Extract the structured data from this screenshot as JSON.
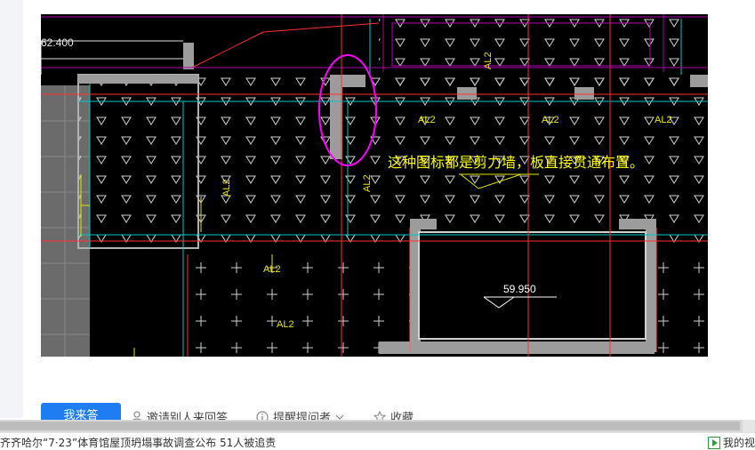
{
  "cad": {
    "elevation_top_left": "62.400",
    "label_al2": "AL2",
    "elevation_center": "59.950",
    "annotation": "这种图标都是剪力墙，板直接贯通布置。"
  },
  "actions": {
    "answer_label": "我来答",
    "invite_label": "邀请别人来回答",
    "remind_label": "提醒提问者",
    "collect_label": "收藏"
  },
  "news": {
    "ticker_text": "齐齐哈尔“7·23”体育馆屋顶坍塌事故调查公布 51人被追责",
    "right_text": "我的视"
  },
  "colors": {
    "accent_blue": "#1e7df2",
    "annotation_yellow": "#ffff00",
    "highlight_magenta": "#ff00ff"
  }
}
